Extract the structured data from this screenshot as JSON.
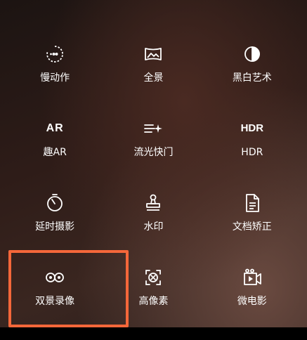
{
  "modes": [
    {
      "label": "慢动作",
      "icon": "slow-motion-icon"
    },
    {
      "label": "全景",
      "icon": "panorama-icon"
    },
    {
      "label": "黑白艺术",
      "icon": "black-white-icon"
    },
    {
      "label": "趣AR",
      "icon": "ar-icon",
      "icon_text": "AR"
    },
    {
      "label": "流光快门",
      "icon": "light-trail-icon"
    },
    {
      "label": "HDR",
      "icon": "hdr-icon",
      "icon_text": "HDR"
    },
    {
      "label": "延时摄影",
      "icon": "timelapse-icon"
    },
    {
      "label": "水印",
      "icon": "stamp-icon"
    },
    {
      "label": "文档矫正",
      "icon": "document-icon"
    },
    {
      "label": "双景录像",
      "icon": "dual-view-icon"
    },
    {
      "label": "高像素",
      "icon": "high-resolution-icon"
    },
    {
      "label": "微电影",
      "icon": "micro-movie-icon"
    }
  ],
  "highlight_color": "#f4673a"
}
